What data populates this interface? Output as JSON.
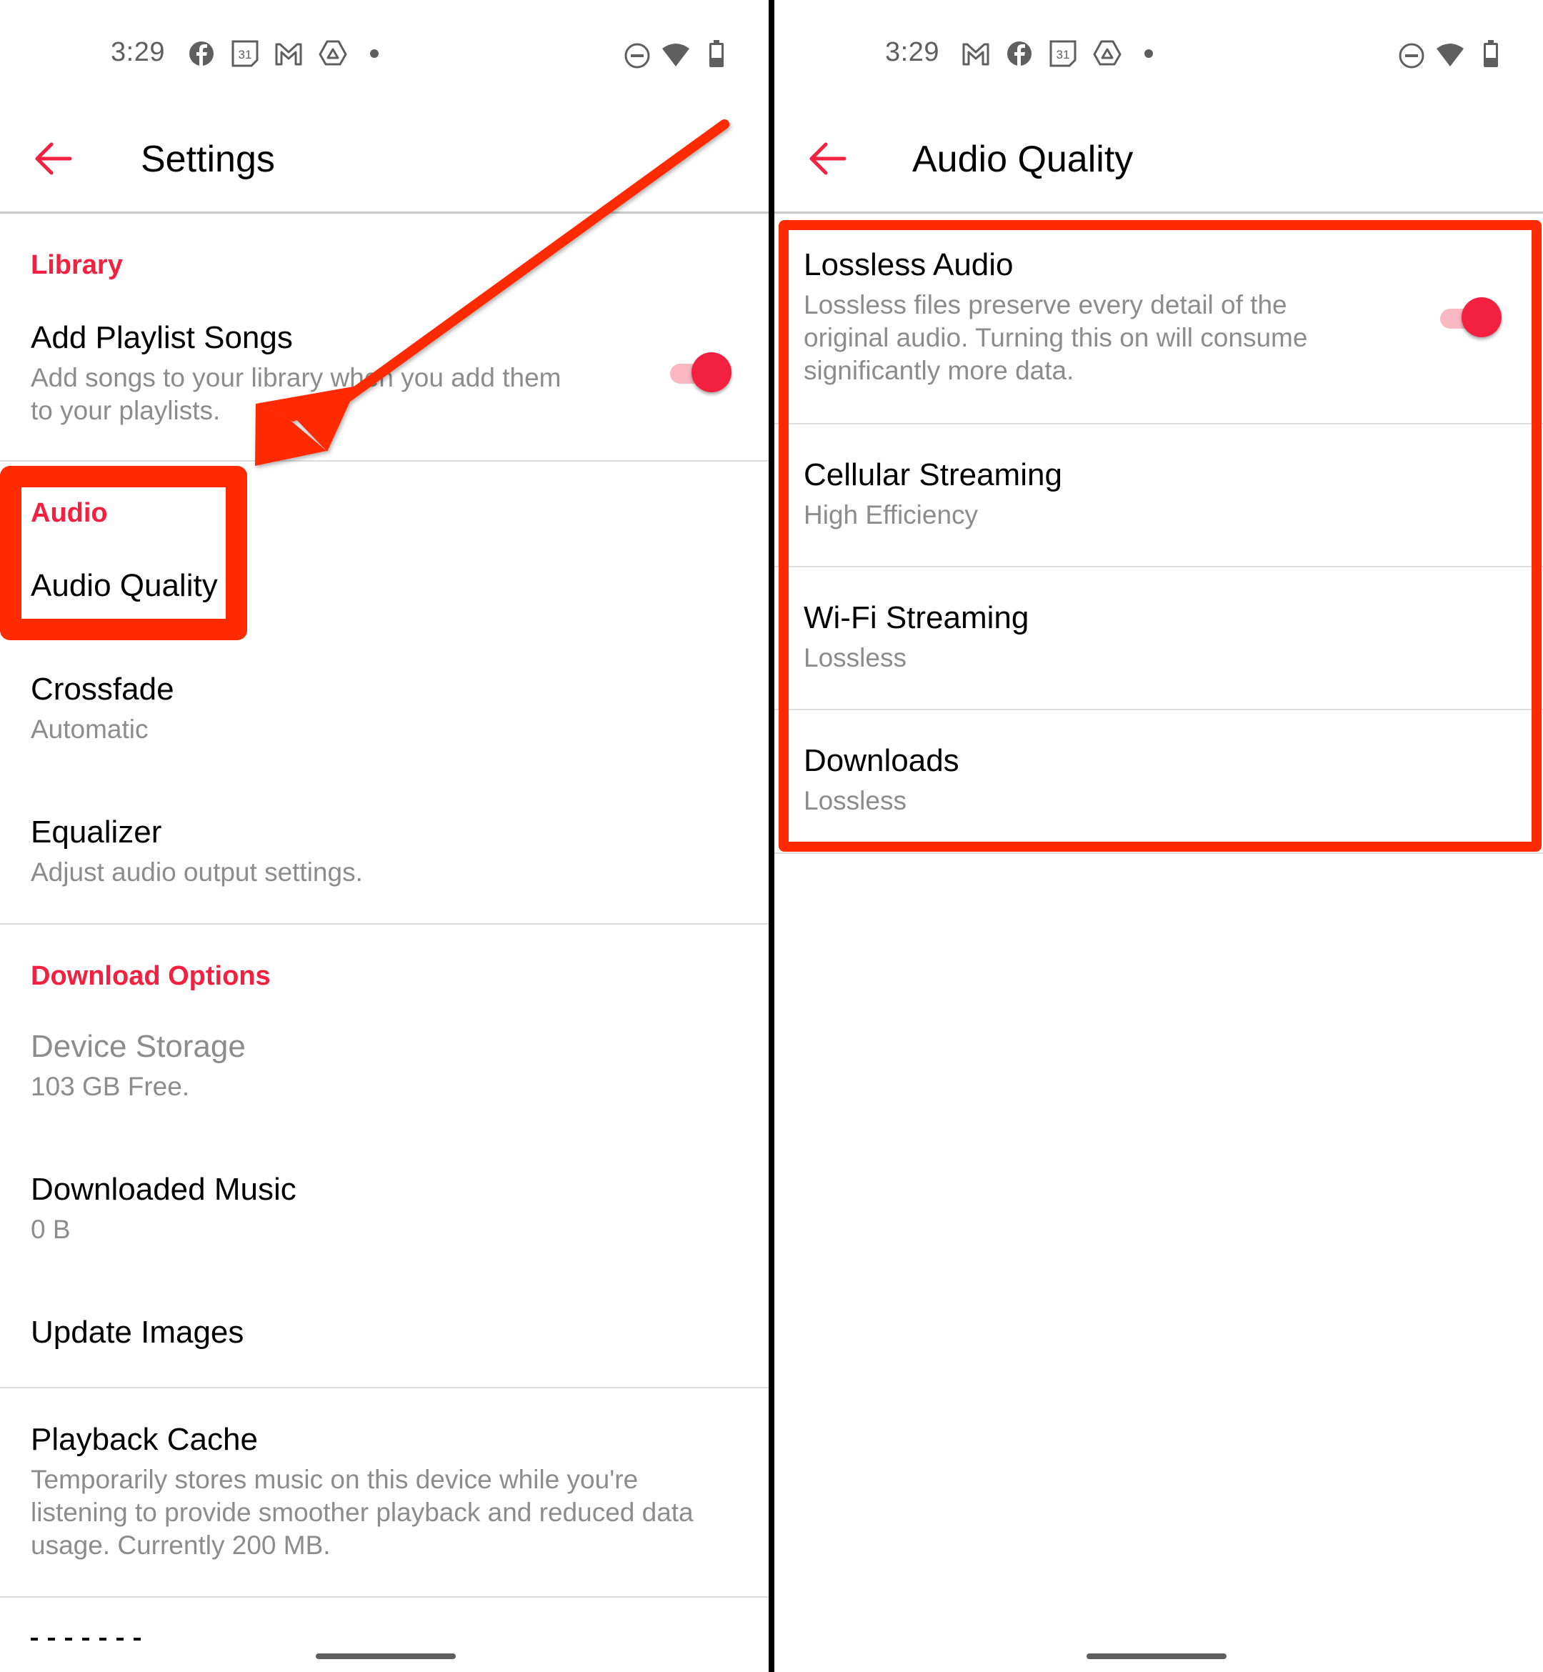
{
  "colors": {
    "accent": "#f3213f",
    "toggle_track": "#f9b8c3",
    "annotation": "#ff2a00",
    "secondary_text": "#8c8c8c",
    "status_icons": "#5f5f5f"
  },
  "left_screen": {
    "status_bar": {
      "time": "3:29",
      "notification_icons": [
        "facebook-icon",
        "calendar-icon",
        "gmail-icon",
        "drive-icon",
        "more-dot-icon"
      ],
      "calendar_day": "31",
      "system_icons": [
        "do-not-disturb-icon",
        "wifi-icon",
        "battery-icon"
      ]
    },
    "toolbar": {
      "back_icon": "back-arrow-icon",
      "title": "Settings"
    },
    "sections": {
      "library": {
        "header": "Library",
        "add_playlist_songs": {
          "title": "Add Playlist Songs",
          "subtitle_line1": "Add songs to your library when you add them",
          "subtitle_line2": "to your playlists.",
          "toggle_on": true
        }
      },
      "audio": {
        "header": "Audio",
        "audio_quality": {
          "title": "Audio Quality"
        },
        "crossfade": {
          "title": "Crossfade",
          "subtitle": "Automatic"
        },
        "equalizer": {
          "title": "Equalizer",
          "subtitle": "Adjust audio output settings."
        }
      },
      "download_options": {
        "header": "Download Options",
        "device_storage": {
          "title": "Device Storage",
          "subtitle": "103 GB Free."
        },
        "downloaded_music": {
          "title": "Downloaded Music",
          "subtitle": "0 B"
        },
        "update_images": {
          "title": "Update Images"
        }
      },
      "playback_cache": {
        "title": "Playback Cache",
        "subtitle_line1": "Temporarily stores music on this device while you're",
        "subtitle_line2": "listening to provide smoother playback and reduced data",
        "subtitle_line3": "usage. Currently 200 MB."
      }
    }
  },
  "right_screen": {
    "status_bar": {
      "time": "3:29",
      "notification_icons": [
        "gmail-icon",
        "facebook-icon",
        "calendar-icon",
        "drive-icon",
        "more-dot-icon"
      ],
      "calendar_day": "31",
      "system_icons": [
        "do-not-disturb-icon",
        "wifi-icon",
        "battery-icon"
      ]
    },
    "toolbar": {
      "back_icon": "back-arrow-icon",
      "title": "Audio Quality"
    },
    "items": {
      "lossless_audio": {
        "title": "Lossless Audio",
        "subtitle_line1": "Lossless files preserve every detail of the",
        "subtitle_line2": "original audio. Turning this on will consume",
        "subtitle_line3": "significantly more data.",
        "toggle_on": true
      },
      "cellular_streaming": {
        "title": "Cellular Streaming",
        "value": "High Efficiency"
      },
      "wifi_streaming": {
        "title": "Wi-Fi Streaming",
        "value": "Lossless"
      },
      "downloads": {
        "title": "Downloads",
        "value": "Lossless"
      }
    }
  },
  "annotations": {
    "arrow": "pointer-arrow pointing to Audio Quality setting",
    "left_highlight": "Audio Quality highlighted",
    "right_highlight": "Audio Quality options highlighted"
  }
}
